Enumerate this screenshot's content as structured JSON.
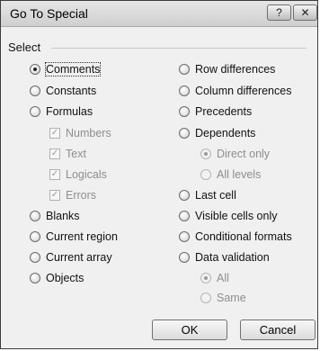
{
  "window": {
    "title": "Go To Special",
    "help_glyph": "?",
    "close_glyph": "✕"
  },
  "select_label": "Select",
  "left_options": [
    {
      "label": "Comments",
      "selected": true
    },
    {
      "label": "Constants",
      "selected": false
    },
    {
      "label": "Formulas",
      "selected": false
    }
  ],
  "formula_types": [
    {
      "label": "Numbers",
      "checked": true
    },
    {
      "label": "Text",
      "checked": true
    },
    {
      "label": "Logicals",
      "checked": true
    },
    {
      "label": "Errors",
      "checked": true
    }
  ],
  "left_options_2": [
    {
      "label": "Blanks",
      "selected": false
    },
    {
      "label": "Current region",
      "selected": false
    },
    {
      "label": "Current array",
      "selected": false
    },
    {
      "label": "Objects",
      "selected": false
    }
  ],
  "right_options": [
    {
      "label": "Row differences",
      "selected": false
    },
    {
      "label": "Column differences",
      "selected": false
    },
    {
      "label": "Precedents",
      "selected": false
    },
    {
      "label": "Dependents",
      "selected": false
    }
  ],
  "dependents_sub": [
    {
      "label": "Direct only",
      "selected": true
    },
    {
      "label": "All levels",
      "selected": false
    }
  ],
  "right_options_2": [
    {
      "label": "Last cell",
      "selected": false
    },
    {
      "label": "Visible cells only",
      "selected": false
    },
    {
      "label": "Conditional formats",
      "selected": false
    },
    {
      "label": "Data validation",
      "selected": false
    }
  ],
  "validation_sub": [
    {
      "label": "All",
      "selected": true
    },
    {
      "label": "Same",
      "selected": false
    }
  ],
  "buttons": {
    "ok": "OK",
    "cancel": "Cancel"
  }
}
